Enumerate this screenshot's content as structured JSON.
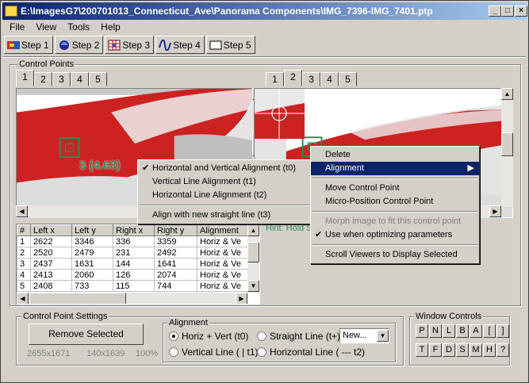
{
  "window": {
    "title": "E:\\ImagesG7\\200701013_Connecticut_Ave\\Panorama Components\\IMG_7396-IMG_7401.ptp",
    "minimize": "_",
    "maximize": "□",
    "close": "×"
  },
  "menu": [
    "File",
    "View",
    "Tools",
    "Help"
  ],
  "toolbar": [
    "Step 1",
    "Step 2",
    "Step 3",
    "Step 4",
    "Step 5"
  ],
  "control_points": {
    "group_label": "Control Points",
    "left_tabs": [
      "1",
      "2",
      "3",
      "4",
      "5"
    ],
    "left_selected": 0,
    "right_tabs": [
      "1",
      "2",
      "3",
      "4",
      "5"
    ],
    "right_selected": 1,
    "left_point_label": "3 (4.63)",
    "hint": "Hint: Hold S"
  },
  "alignment_submenu": {
    "items": [
      {
        "label": "Horizontal and Vertical Alignment (t0)",
        "checked": true
      },
      {
        "label": "Vertical Line Alignment (t1)",
        "checked": false
      },
      {
        "label": "Horizontal Line Alignment (t2)",
        "checked": false
      }
    ],
    "extra": "Align with new straight line (t3)"
  },
  "context_menu": {
    "delete": "Delete",
    "alignment": "Alignment",
    "move": "Move Control Point",
    "micro": "Micro-Position Control Point",
    "morph": "Morph image to fit this control point",
    "use_optimizing": "Use when optimizing parameters",
    "scroll": "Scroll Viewers to Display Selected"
  },
  "table": {
    "headers": [
      "#",
      "Left x",
      "Left y",
      "Right x",
      "Right y",
      "Alignment"
    ],
    "rows": [
      [
        "1",
        "2622",
        "3346",
        "336",
        "3359",
        "Horiz & Ve"
      ],
      [
        "2",
        "2520",
        "2479",
        "231",
        "2492",
        "Horiz & Ve"
      ],
      [
        "3",
        "2437",
        "1631",
        "144",
        "1641",
        "Horiz & Ve"
      ],
      [
        "4",
        "2413",
        "2060",
        "126",
        "2074",
        "Horiz & Ve"
      ],
      [
        "5",
        "2408",
        "733",
        "115",
        "744",
        "Horiz & Ve"
      ]
    ]
  },
  "settings": {
    "group_label": "Control Point Settings",
    "remove": "Remove Selected",
    "dim_left": "2655x1671",
    "dim_right": "140x1639",
    "zoom": "100%",
    "alignment_label": "Alignment",
    "opt_hv": "Horiz + Vert (t0)",
    "opt_straight": "Straight Line (t+):",
    "opt_vline": "Vertical Line ( | t1)",
    "opt_hline": "Horizontal Line ( --- t2)",
    "new_value": "New..."
  },
  "window_controls": {
    "label": "Window Controls",
    "row1": [
      "P",
      "N",
      "L",
      "B",
      "A",
      "[",
      "]"
    ],
    "row2": [
      "T",
      "F",
      "D",
      "S",
      "M",
      "H",
      "?"
    ]
  },
  "colors": {
    "title_start": "#0a246a",
    "title_end": "#a6caf0",
    "highlight": "#0a246a",
    "point": "#2e8b57",
    "red": "#d42a2a"
  }
}
